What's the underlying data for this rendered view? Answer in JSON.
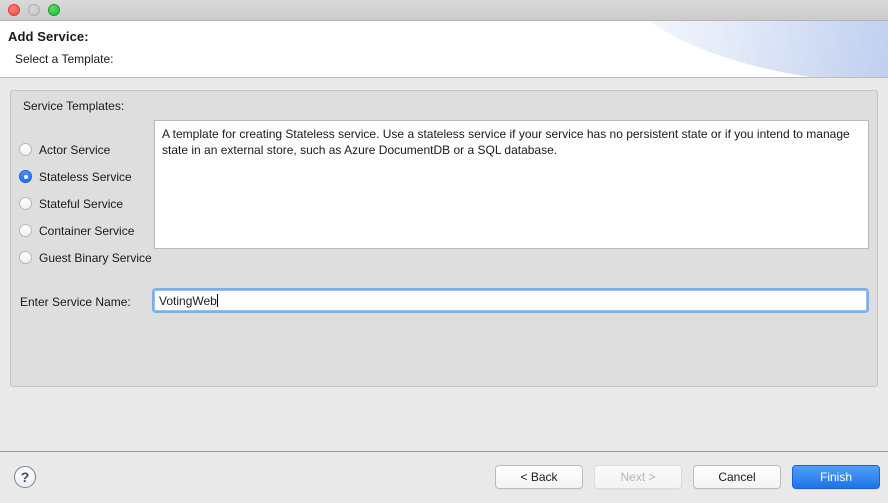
{
  "titlebar": {
    "buttons": [
      {
        "name": "close",
        "label": "close-window"
      },
      {
        "name": "minimize",
        "label": "minimize-window"
      },
      {
        "name": "maximize",
        "label": "maximize-window"
      }
    ]
  },
  "header": {
    "title": "Add Service:",
    "subtitle": "Select a Template:"
  },
  "panel": {
    "title": "Service Templates:",
    "templates": [
      {
        "label": "Actor Service",
        "selected": false
      },
      {
        "label": "Stateless Service",
        "selected": true
      },
      {
        "label": "Stateful Service",
        "selected": false
      },
      {
        "label": "Container Service",
        "selected": false
      },
      {
        "label": "Guest Binary Service",
        "selected": false
      }
    ],
    "description": "A template for creating Stateless service.  Use a stateless service if your service has no persistent state or if you intend to manage state in an external store, such as Azure DocumentDB or a SQL database.",
    "service_name": {
      "label": "Enter Service Name:",
      "value": "VotingWeb",
      "placeholder": ""
    }
  },
  "footer": {
    "help_glyph": "?",
    "buttons": [
      {
        "label": "< Back",
        "state": "enabled"
      },
      {
        "label": "Next >",
        "state": "disabled"
      },
      {
        "label": "Cancel",
        "state": "enabled"
      },
      {
        "label": "Finish",
        "state": "primary"
      }
    ]
  },
  "colors": {
    "accent_blue": "#2d7ff9",
    "primary_button": "#1f72e8",
    "panel_bg": "#dedede",
    "window_bg": "#e9e9e9",
    "close_dot": "#f24b41",
    "minimize_dot": "#c2c2c2",
    "maximize_dot": "#1db92f"
  }
}
